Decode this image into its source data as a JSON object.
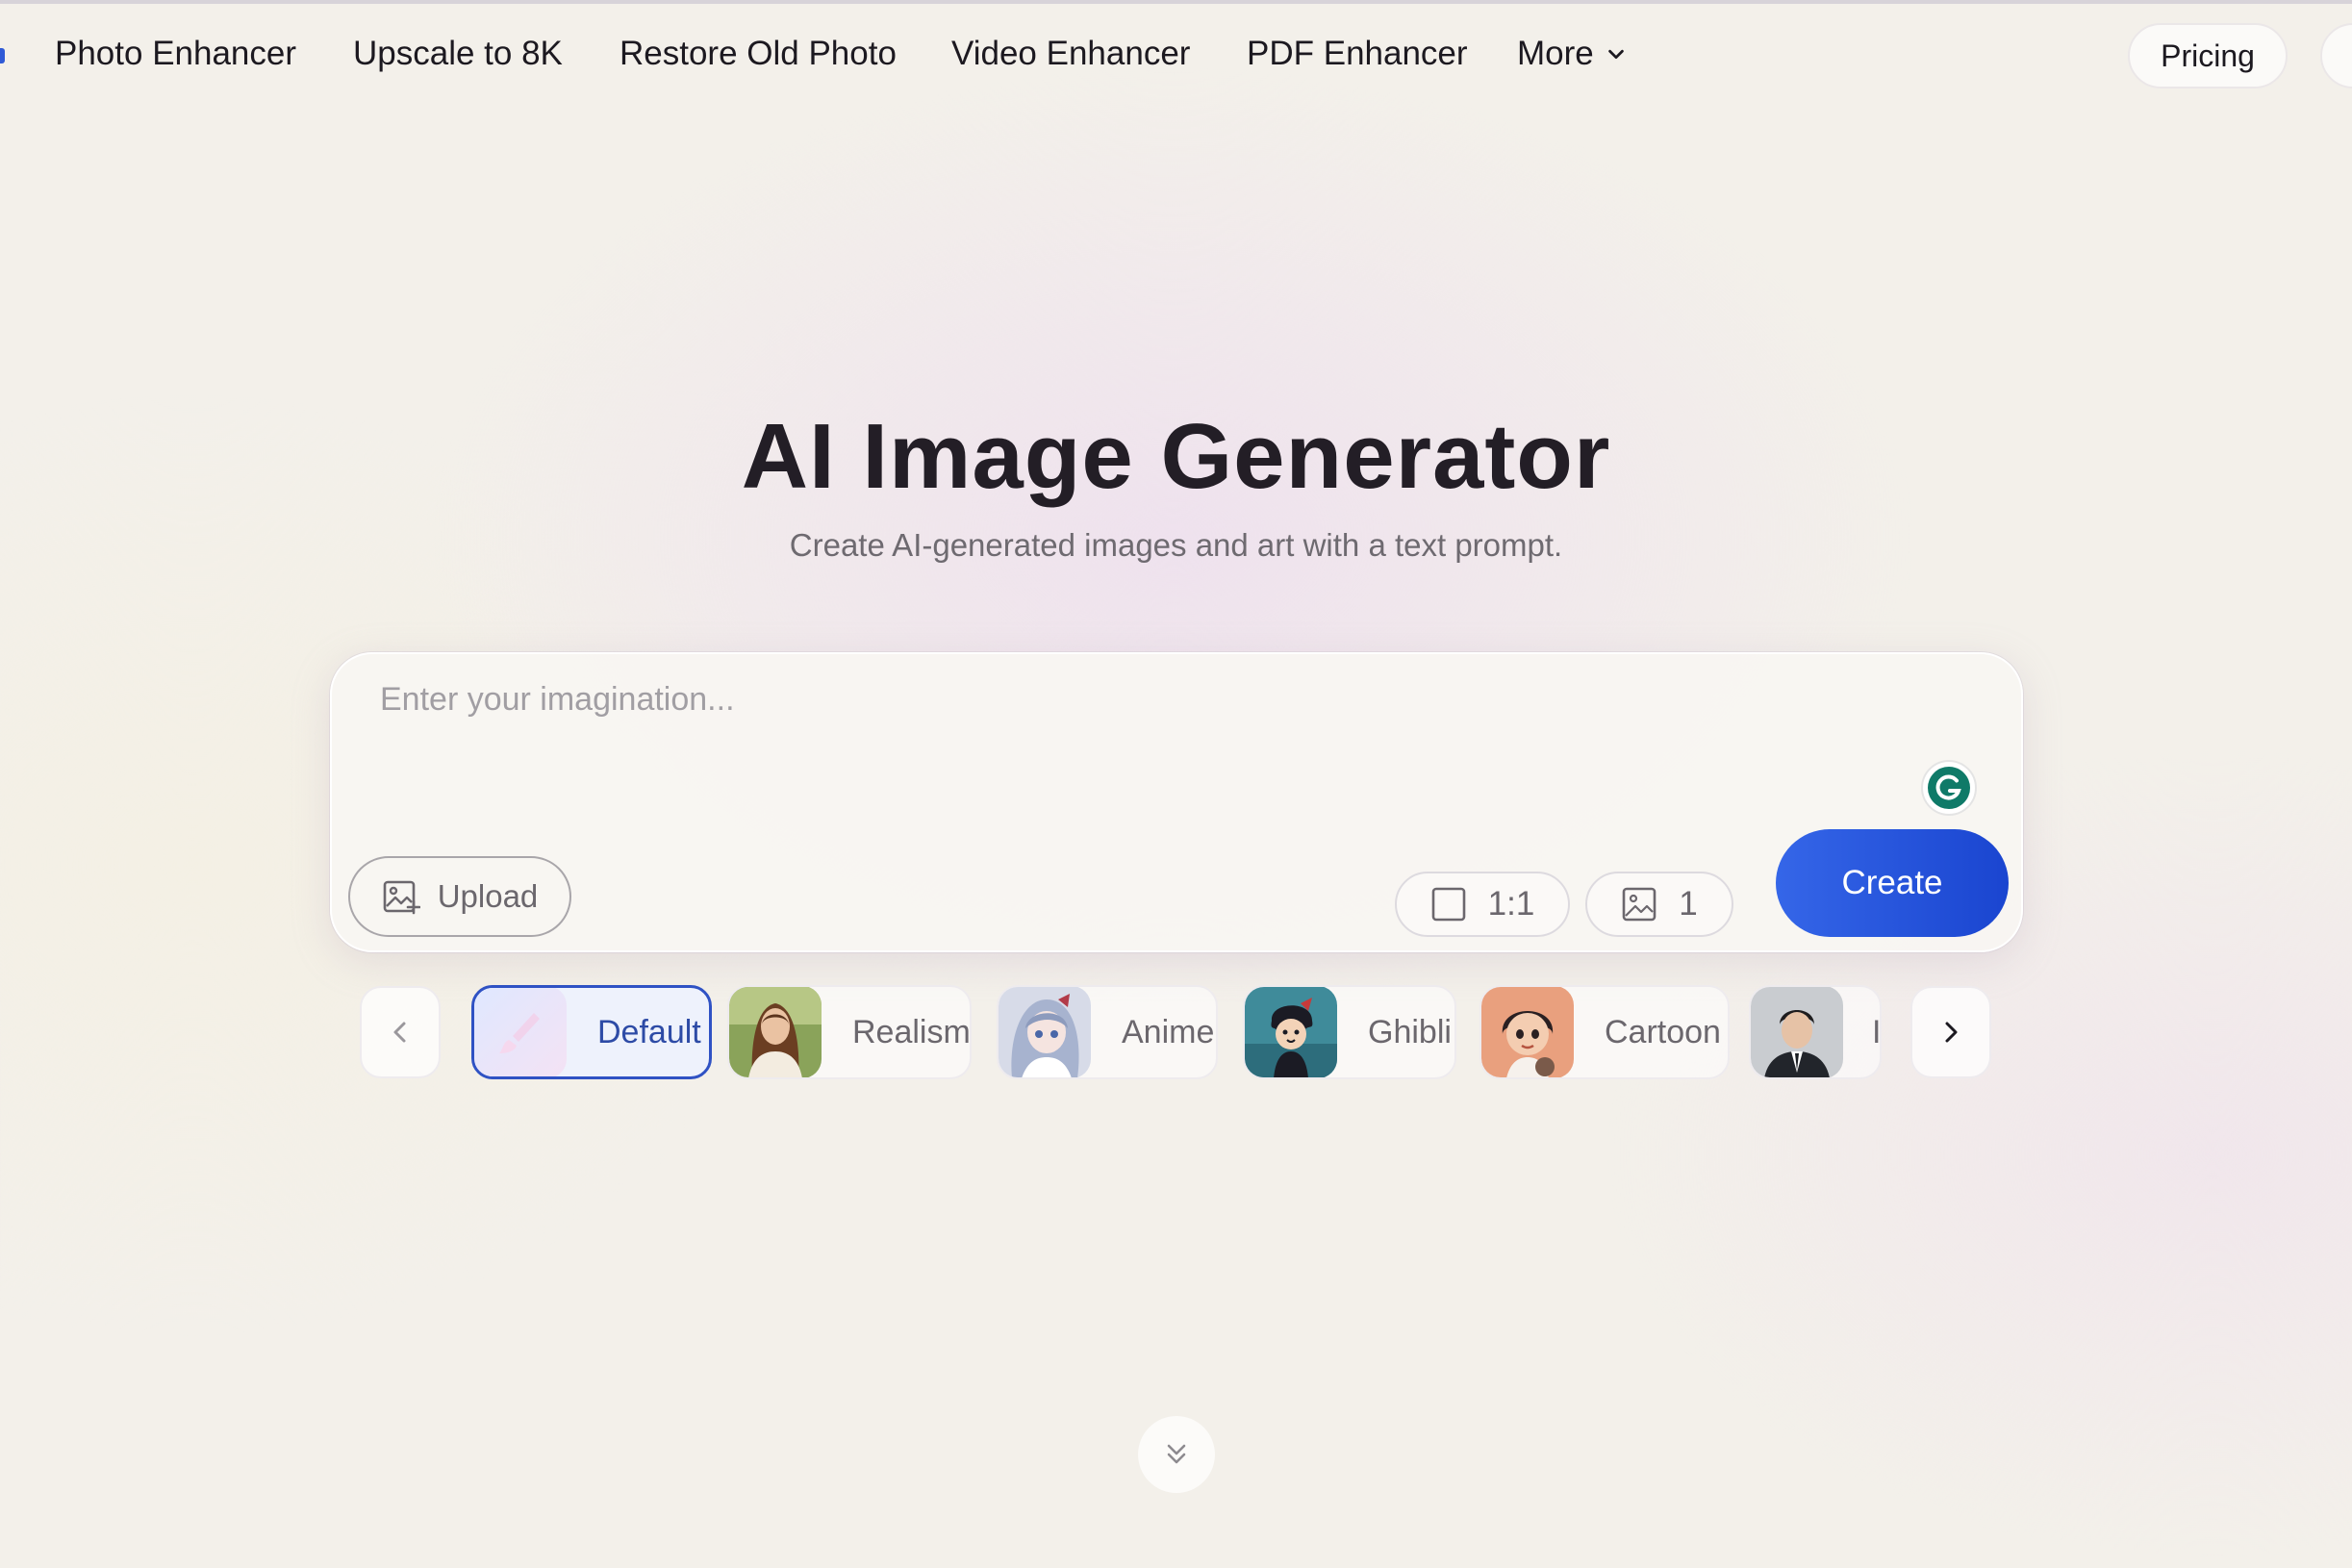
{
  "nav": {
    "items": [
      {
        "label": "Photo Enhancer"
      },
      {
        "label": "Upscale to 8K"
      },
      {
        "label": "Restore Old Photo"
      },
      {
        "label": "Video Enhancer"
      },
      {
        "label": "PDF Enhancer"
      }
    ],
    "more_label": "More",
    "pricing_label": "Pricing"
  },
  "hero": {
    "title": "AI Image Generator",
    "subtitle": "Create AI-generated images and art with a text prompt."
  },
  "prompt": {
    "placeholder": "Enter your imagination...",
    "value": "",
    "upload_label": "Upload",
    "aspect_ratio": "1:1",
    "image_count": "1",
    "create_label": "Create"
  },
  "styles": {
    "selected": "Default",
    "items": [
      {
        "label": "Default"
      },
      {
        "label": "Realism"
      },
      {
        "label": "Anime"
      },
      {
        "label": "Ghibli"
      },
      {
        "label": "Cartoon"
      },
      {
        "label": "I"
      }
    ]
  },
  "colors": {
    "accent": "#2357dd",
    "selected_border": "#2f52c4",
    "grammarly": "#15c39a"
  },
  "icons": {
    "upload": "image-upload-icon",
    "ratio": "square-icon",
    "count": "image-icon",
    "prev": "chevron-left-icon",
    "next": "chevron-right-icon",
    "more": "chevron-down-icon",
    "scroll": "double-chevron-down-icon",
    "assistant": "grammarly-icon"
  }
}
